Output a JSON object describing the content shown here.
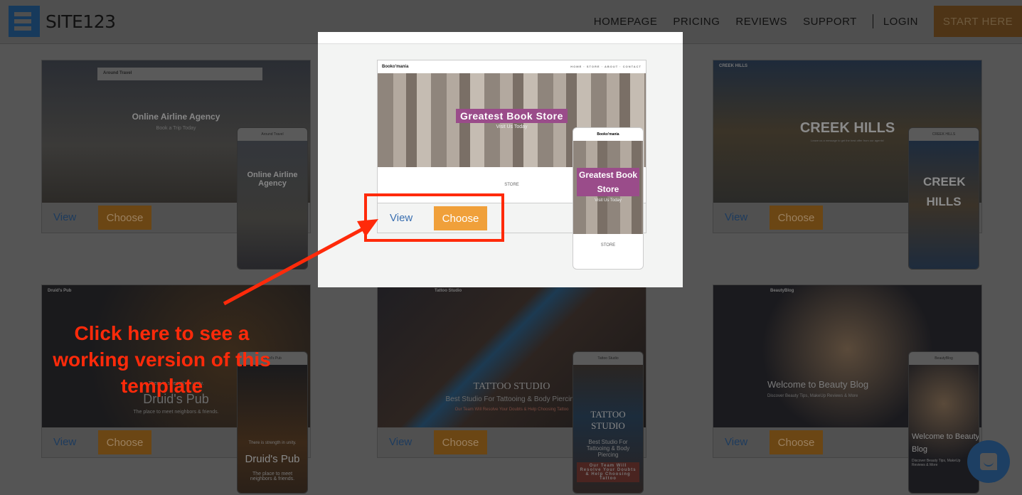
{
  "header": {
    "logo_text": "SITE123",
    "nav": [
      "HOMEPAGE",
      "PRICING",
      "REVIEWS",
      "SUPPORT",
      "LOGIN"
    ],
    "cta": "START HERE"
  },
  "buttons": {
    "view": "View",
    "choose": "Choose"
  },
  "templates": [
    {
      "brand": "Around Travel",
      "title": "Online Airline Agency",
      "subtitle": "Book a Trip Today",
      "mobile_title": "Online Airline Agency"
    },
    {
      "brand": "Booko'mania",
      "title": "Greatest Book Store",
      "subtitle": "Visit Us Today",
      "section": "STORE",
      "mobile_title": "Greatest Book Store"
    },
    {
      "brand": "CREEK HILLS",
      "title": "CREEK HILLS",
      "subtitle": "Leave us a message to get the best offer from our agents!",
      "mobile_title": "CREEK HILLS"
    },
    {
      "brand": "Druid's Pub",
      "title": "Druid's Pub",
      "subtitle": "The place to meet neighbors & friends.",
      "tagline": "There is strength in unity.",
      "mobile_title": "Druid's Pub"
    },
    {
      "brand": "Tattoo Studio",
      "title": "TATTOO STUDIO",
      "subtitle": "Best Studio For Tattooing & Body Piercing",
      "tagline": "Our Team Will Resolve Your Doubts & Help Choosing Tattoo",
      "mobile_title": "TATTOO STUDIO"
    },
    {
      "brand": "BeautyBlog",
      "title": "Welcome to Beauty Blog",
      "subtitle": "Discover Beauty Tips, MakeUp Reviews & More",
      "mobile_title": "Welcome to Beauty Blog"
    }
  ],
  "annotation": {
    "text": "Click here to see a working version of this template",
    "color": "#ff2a0a"
  },
  "colors": {
    "choose_button": "#f0a03a",
    "view_link": "#3a6fb0",
    "chat_bubble": "#1d3f63"
  },
  "icons": [
    "menu-icon",
    "chat-icon",
    "arrow-icon"
  ]
}
